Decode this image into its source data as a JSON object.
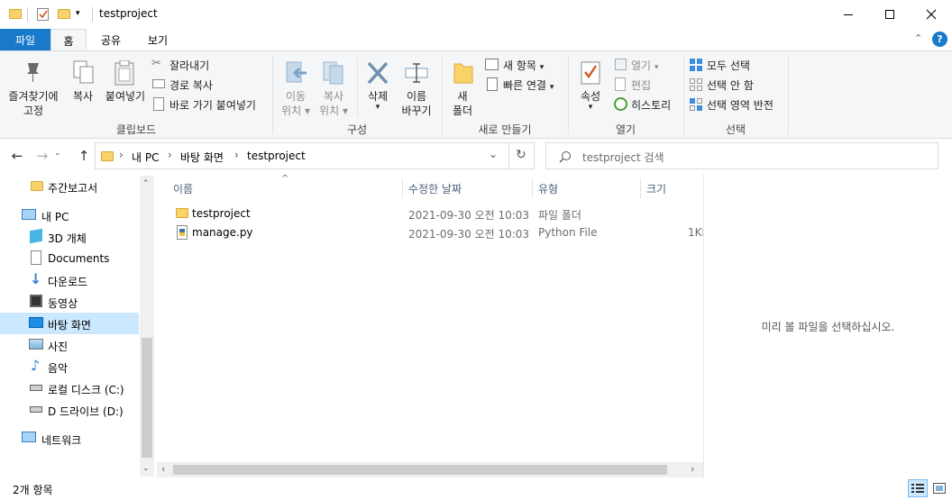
{
  "window": {
    "title": "testproject"
  },
  "ribbon_tabs": [
    "파일",
    "홈",
    "공유",
    "보기"
  ],
  "ribbon": {
    "clipboard": {
      "pin_line1": "즐겨찾기에",
      "pin_line2": "고정",
      "copy": "복사",
      "paste": "붙여넣기",
      "cut": "잘라내기",
      "copy_path": "경로 복사",
      "paste_shortcut": "바로 가기 붙여넣기",
      "label": "클립보드"
    },
    "organize": {
      "move_line1": "이동",
      "move_line2": "위치",
      "copyto_line1": "복사",
      "copyto_line2": "위치",
      "delete": "삭제",
      "rename_line1": "이름",
      "rename_line2": "바꾸기",
      "label": "구성"
    },
    "new": {
      "folder_line1": "새",
      "folder_line2": "폴더",
      "new_item": "새 항목",
      "easy_access": "빠른 연결",
      "label": "새로 만들기"
    },
    "open": {
      "properties": "속성",
      "open": "열기",
      "edit": "편집",
      "history": "히스토리",
      "label": "열기"
    },
    "select": {
      "select_all": "모두 선택",
      "select_none": "선택 안 함",
      "invert": "선택 영역 반전",
      "label": "선택"
    }
  },
  "address": {
    "breadcrumb": [
      "내 PC",
      "바탕 화면",
      "testproject"
    ],
    "search_placeholder": "testproject 검색"
  },
  "nav": {
    "items": [
      {
        "label": "주간보고서",
        "icon": "folder-icon"
      },
      {
        "label": "내 PC",
        "icon": "pc-icon"
      },
      {
        "label": "3D 개체",
        "icon": "cube-icon"
      },
      {
        "label": "Documents",
        "icon": "document-icon"
      },
      {
        "label": "다운로드",
        "icon": "download-icon"
      },
      {
        "label": "동영상",
        "icon": "video-icon"
      },
      {
        "label": "바탕 화면",
        "icon": "desktop-icon"
      },
      {
        "label": "사진",
        "icon": "picture-icon"
      },
      {
        "label": "음악",
        "icon": "music-icon"
      },
      {
        "label": "로컬 디스크 (C:)",
        "icon": "drive-icon"
      },
      {
        "label": "D 드라이브 (D:)",
        "icon": "drive-icon"
      },
      {
        "label": "네트워크",
        "icon": "network-icon"
      }
    ]
  },
  "files": {
    "columns": [
      "이름",
      "수정한 날짜",
      "유형",
      "크기"
    ],
    "rows": [
      {
        "name": "testproject",
        "date": "2021-09-30 오전 10:03",
        "type": "파일 폴더",
        "size": ""
      },
      {
        "name": "manage.py",
        "date": "2021-09-30 오전 10:03",
        "type": "Python File",
        "size": "1KI"
      }
    ]
  },
  "preview": {
    "message": "미리 볼 파일을 선택하십시오."
  },
  "status": {
    "item_count": "2개 항목"
  },
  "colors": {
    "accent": "#1979ca",
    "selected": "#cce8ff",
    "folder": "#f8d36a"
  }
}
